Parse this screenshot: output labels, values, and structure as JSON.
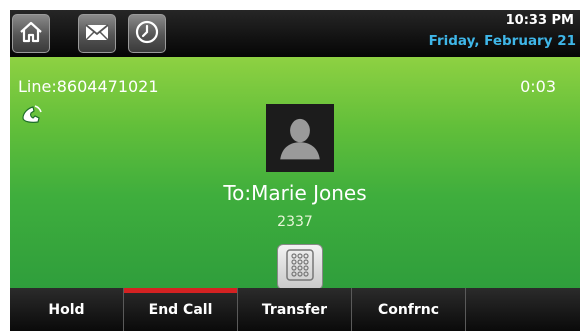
{
  "status": {
    "time": "10:33 PM",
    "date": "Friday, February 21"
  },
  "toolbar": {
    "icons": [
      "home-icon",
      "envelope-icon",
      "clock-icon"
    ]
  },
  "call": {
    "line": "Line:8604471021",
    "duration": "0:03",
    "to": "To:Marie Jones",
    "number": "2337"
  },
  "softkeys": [
    {
      "label": "Hold"
    },
    {
      "label": "End Call",
      "active": true
    },
    {
      "label": "Transfer"
    },
    {
      "label": "Confrnc"
    },
    {
      "label": ""
    }
  ],
  "colors": {
    "accent_date": "#3fb6e8",
    "end_call_indicator": "#d42222",
    "call_bg_top": "#8ed142",
    "call_bg_bottom": "#2f9e3c"
  }
}
